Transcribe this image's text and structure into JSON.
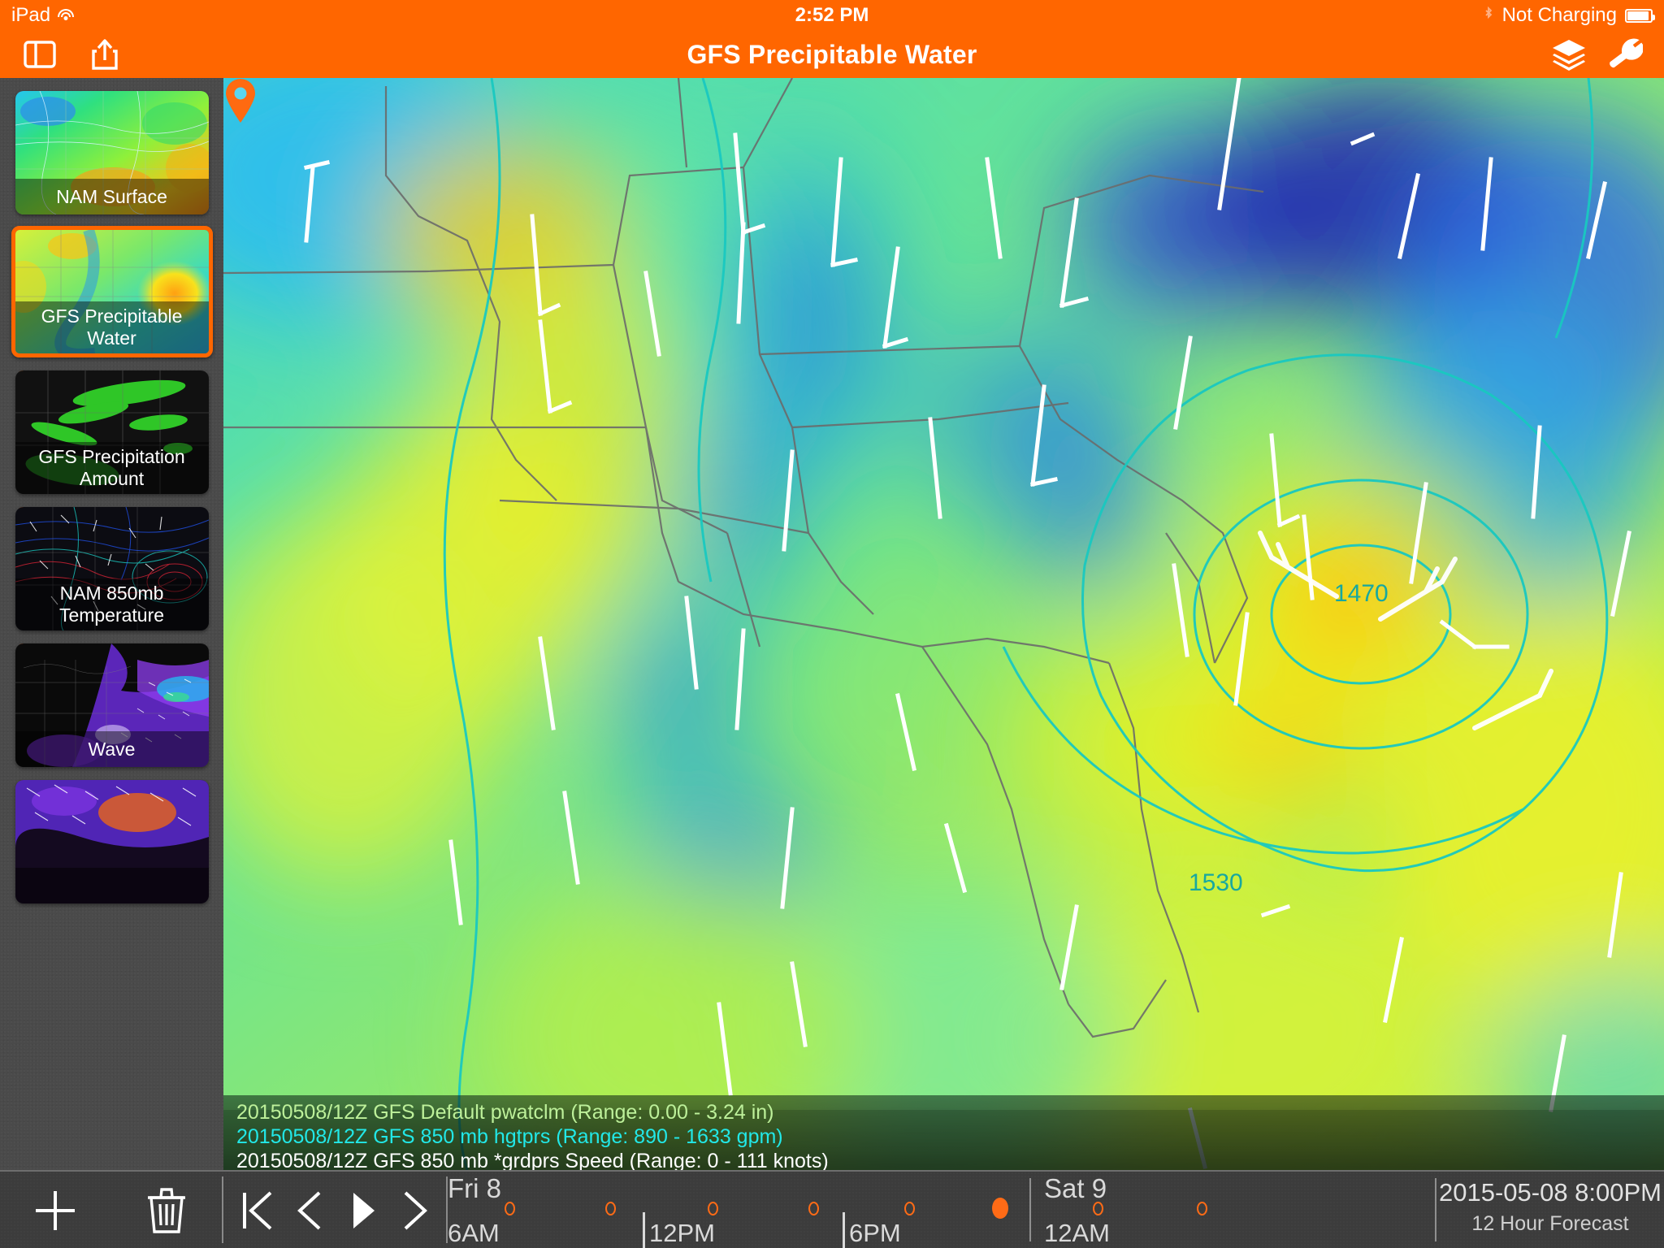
{
  "statusbar": {
    "device": "iPad",
    "wifi_icon": "wifi-icon",
    "time": "2:52 PM",
    "bluetooth_icon": "bluetooth-icon",
    "battery_state": "Not Charging",
    "battery_icon": "battery-icon"
  },
  "navbar": {
    "title": "GFS Precipitable Water",
    "sidebar_toggle_icon": "sidebar-toggle-icon",
    "share_icon": "share-icon",
    "layers_icon": "layers-icon",
    "wrench_icon": "wrench-icon",
    "accent": "#FF6600"
  },
  "sidebar": {
    "items": [
      {
        "label": "NAM Surface",
        "selected": false
      },
      {
        "label": "GFS Precipitable Water",
        "selected": true
      },
      {
        "label": "GFS Precipitation Amount",
        "selected": false
      },
      {
        "label": "NAM 850mb Temperature",
        "selected": false
      },
      {
        "label": "Wave",
        "selected": false
      },
      {
        "label": "",
        "selected": false
      }
    ]
  },
  "map": {
    "marker_icon": "map-pin-icon",
    "contour_labels": [
      "1470",
      "1530"
    ],
    "contour_color": "#19c8c0"
  },
  "legend": {
    "line1": "20150508/12Z GFS Default pwatclm (Range: 0.00 - 3.24 in)",
    "line2": "20150508/12Z GFS 850 mb hgtprs (Range: 890 - 1633 gpm)",
    "line3": "20150508/12Z GFS 850 mb *grdprs Speed (Range: 0 - 111 knots)",
    "color1": "#bdf09a",
    "color2": "#22e8e8",
    "color3": "#ffffff"
  },
  "bottombar": {
    "add_icon": "plus-icon",
    "delete_icon": "trash-icon",
    "transport": {
      "first_icon": "skip-to-start-icon",
      "prev_icon": "step-backward-icon",
      "play_icon": "play-icon",
      "next_icon": "step-forward-icon"
    },
    "timeline": {
      "days": [
        {
          "name": "Fri 8",
          "time": "6AM"
        },
        {
          "name": "Sat 9",
          "time": "12AM"
        }
      ],
      "day1_label": "Fri 8",
      "day1_time": "6AM",
      "midday_time": "12PM",
      "evening_time": "6PM",
      "day2_label": "Sat 9",
      "day2_time": "12AM",
      "marker_color": "#FF6B16"
    },
    "readout": {
      "datetime": "2015-05-08 8:00PM",
      "forecast": "12 Hour Forecast"
    }
  }
}
